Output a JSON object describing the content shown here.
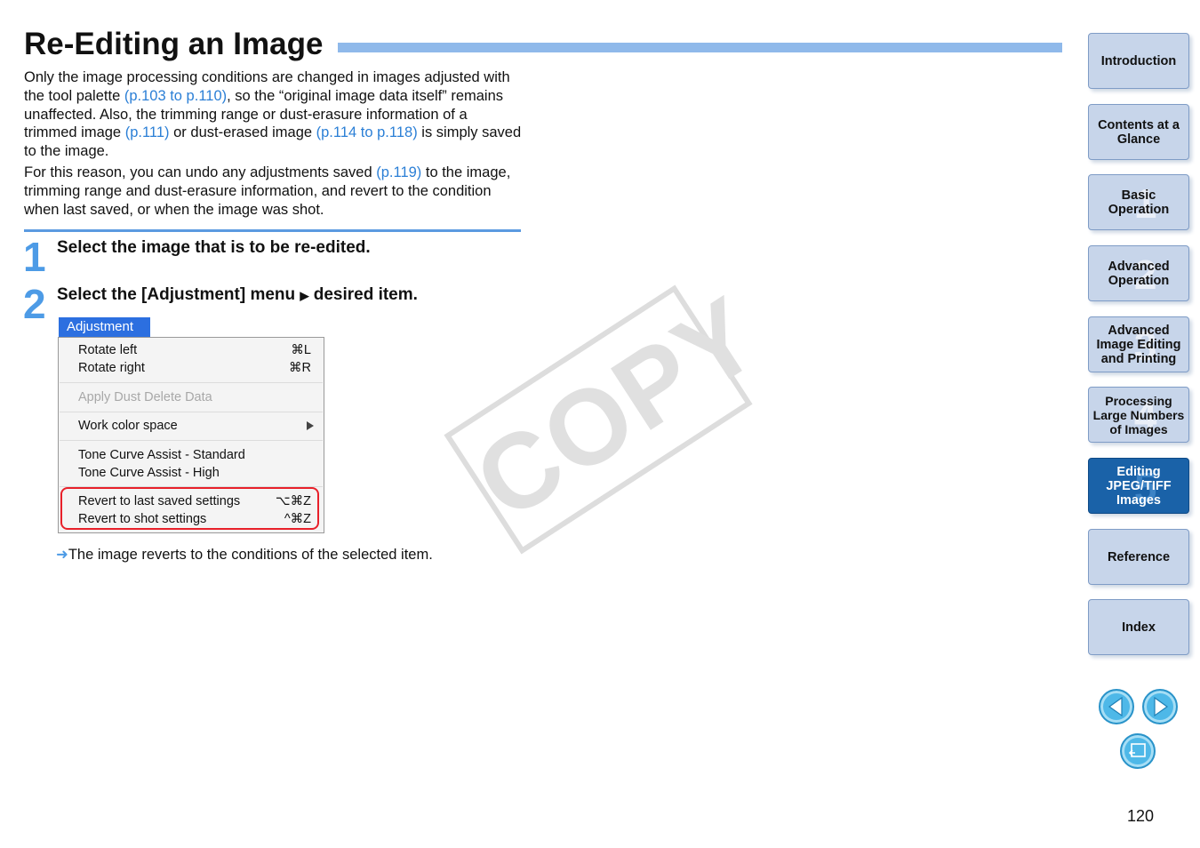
{
  "title": "Re-Editing an Image",
  "intro": {
    "p1": {
      "t1": "Only the image processing conditions are changed in images adjusted with the tool palette ",
      "l1": "(p.103 to p.110)",
      "t2": ", so the “original image data itself” remains unaffected. Also, the trimming range or dust-erasure information of a trimmed image ",
      "l2": "(p.111)",
      "t3": " or dust-erased image ",
      "l3": "(p.114 to p.118)",
      "t4": " is simply saved to the image."
    },
    "p2": {
      "t1": "For this reason, you can undo any adjustments saved ",
      "l1": "(p.119)",
      "t2": " to the image, trimming range and dust-erasure information, and revert to the condition when last saved, or when the image was shot."
    }
  },
  "steps": [
    {
      "num": "1",
      "text": "Select the image that is to be re-edited."
    },
    {
      "num": "2",
      "text_a": "Select the [Adjustment] menu",
      "arrow": "▶",
      "text_b": " desired item."
    }
  ],
  "menu": {
    "tab": "Adjustment",
    "items": [
      {
        "label": "Rotate left",
        "shortcut": "⌘L"
      },
      {
        "label": "Rotate right",
        "shortcut": "⌘R"
      },
      {
        "label": "Apply Dust Delete Data",
        "shortcut": ""
      },
      {
        "label": "Work color space",
        "shortcut": ""
      },
      {
        "label": "Tone Curve Assist - Standard",
        "shortcut": ""
      },
      {
        "label": "Tone Curve Assist - High",
        "shortcut": ""
      },
      {
        "label": "Revert to last saved settings",
        "shortcut": "⌥⌘Z"
      },
      {
        "label": "Revert to shot settings",
        "shortcut": "^⌘Z"
      }
    ]
  },
  "result": {
    "arrow": "➜",
    "text": "The image reverts to the conditions of the selected item."
  },
  "watermark": "COPY",
  "nav": [
    {
      "label": "Introduction",
      "num": ""
    },
    {
      "label": "Contents at a Glance",
      "num": ""
    },
    {
      "label": "Basic Operation",
      "num": "1"
    },
    {
      "label": "Advanced Operation",
      "num": "2"
    },
    {
      "label": "Advanced Image Editing and Printing",
      "num": "3"
    },
    {
      "label": "Processing Large Numbers of Images",
      "num": "4"
    },
    {
      "label": "Editing JPEG/TIFF Images",
      "num": "5"
    },
    {
      "label": "Reference",
      "num": ""
    },
    {
      "label": "Index",
      "num": ""
    }
  ],
  "page_number": "120",
  "colors": {
    "accent": "#4d9be6",
    "link": "#2b7fd6",
    "active_nav": "#1a62a8",
    "highlight": "#e8202a"
  }
}
